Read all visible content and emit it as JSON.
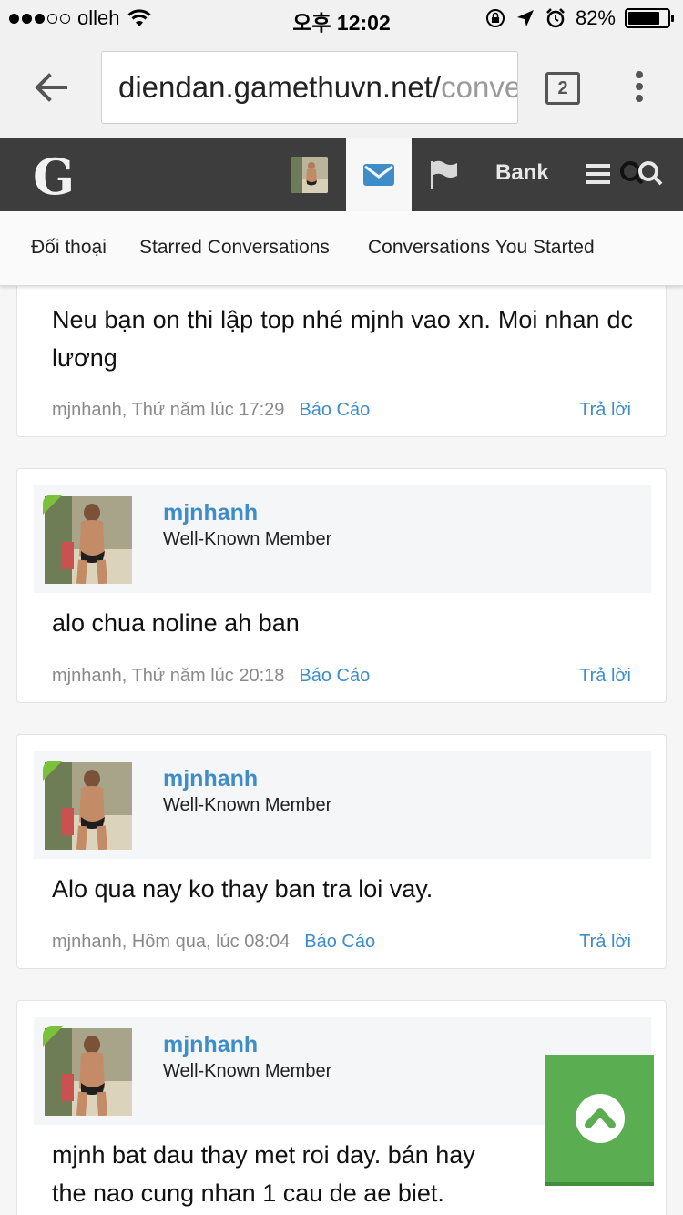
{
  "status_bar": {
    "carrier": "olleh",
    "time": "오후 12:02",
    "battery": "82%",
    "battery_level": 0.82
  },
  "browser": {
    "url_main": "diendan.gamethuvn.net/",
    "url_rest": "conve",
    "tab_count": "2"
  },
  "site_nav": {
    "logo": "G",
    "bank_label": "Bank"
  },
  "sub_nav": {
    "items": [
      "Đối thoại",
      "Starred Conversations",
      "Conversations You Started"
    ]
  },
  "messages": [
    {
      "text": "Neu bạn on thi lập top nhé mjnh vao xn. Moi nhan dc lương",
      "meta": "mjnhanh, Thứ năm lúc 17:29",
      "report": "Báo Cáo",
      "reply": "Trả lời"
    },
    {
      "username": "mjnhanh",
      "user_title": "Well-Known Member",
      "text": "alo chua noline ah ban",
      "meta": "mjnhanh, Thứ năm lúc 20:18",
      "report": "Báo Cáo",
      "reply": "Trả lời"
    },
    {
      "username": "mjnhanh",
      "user_title": "Well-Known Member",
      "text": "Alo qua nay ko thay ban tra loi vay.",
      "meta": "mjnhanh, Hôm qua, lúc 08:04",
      "report": "Báo Cáo",
      "reply": "Trả lời"
    },
    {
      "username": "mjnhanh",
      "user_title": "Well-Known Member",
      "text_line1": "mjnh bat dau thay met roi day. bán hay",
      "text_line2": "the nao cung nhan 1 cau de ae biet."
    }
  ],
  "colors": {
    "link_blue": "#3e8dc9",
    "nav_dark": "#3d3d3d",
    "online_green": "#7cc13c",
    "back_to_top_green": "#5bad52"
  },
  "icons": [
    "back-arrow-icon",
    "wifi-icon",
    "lock-rotation-icon",
    "location-arrow-icon",
    "alarm-icon",
    "mail-icon",
    "flag-icon",
    "menu-icon",
    "search-icon",
    "chevron-up-icon"
  ]
}
